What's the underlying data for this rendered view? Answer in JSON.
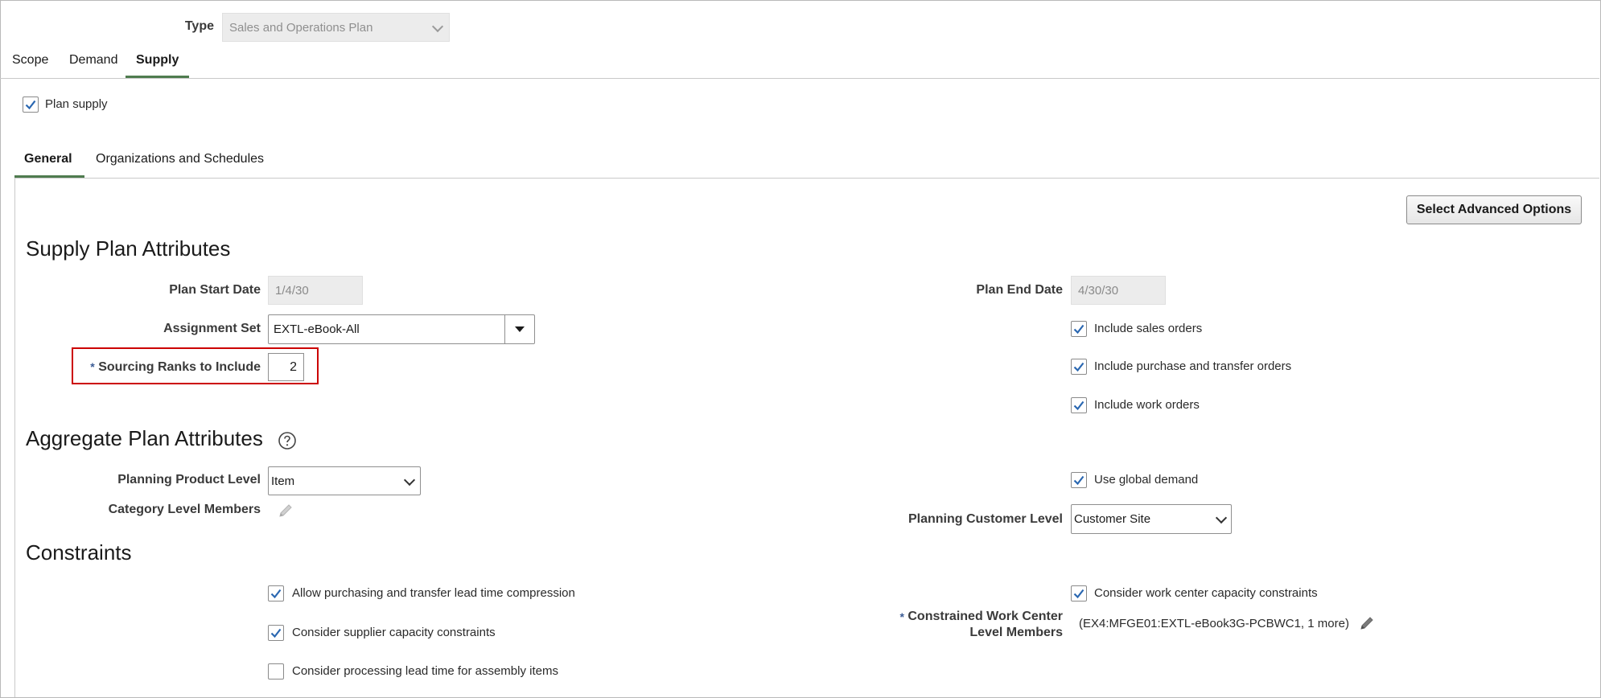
{
  "type_field": {
    "label": "Type",
    "value": "Sales and Operations Plan"
  },
  "main_tabs": [
    {
      "label": "Scope",
      "active": false
    },
    {
      "label": "Demand",
      "active": false
    },
    {
      "label": "Supply",
      "active": true
    }
  ],
  "plan_supply": {
    "label": "Plan supply",
    "checked": true
  },
  "sub_tabs": [
    {
      "label": "General",
      "active": true
    },
    {
      "label": "Organizations and Schedules",
      "active": false
    }
  ],
  "advanced_button": "Select Advanced Options",
  "supply_plan": {
    "title": "Supply Plan Attributes",
    "start_date": {
      "label": "Plan Start Date",
      "value": "1/4/30"
    },
    "end_date": {
      "label": "Plan End Date",
      "value": "4/30/30"
    },
    "assignment_set": {
      "label": "Assignment Set",
      "value": "EXTL-eBook-All"
    },
    "sourcing_ranks": {
      "required_mark": "*",
      "label": "Sourcing Ranks to Include",
      "value": "2"
    },
    "include_sales_orders": {
      "label": "Include sales orders",
      "checked": true
    },
    "include_purchase_orders": {
      "label": "Include purchase and transfer orders",
      "checked": true
    },
    "include_work_orders": {
      "label": "Include work orders",
      "checked": true
    }
  },
  "aggregate_plan": {
    "title": "Aggregate Plan Attributes",
    "help_icon": "question-circle-icon",
    "product_level": {
      "label": "Planning Product Level",
      "value": "Item"
    },
    "category_members": {
      "label": "Category Level Members"
    },
    "use_global_demand": {
      "label": "Use global demand",
      "checked": true
    },
    "customer_level": {
      "label": "Planning Customer Level",
      "value": "Customer Site"
    }
  },
  "constraints": {
    "title": "Constraints",
    "allow_lead_time": {
      "label": "Allow purchasing and transfer lead time compression",
      "checked": true
    },
    "supplier_capacity": {
      "label": "Consider supplier capacity constraints",
      "checked": true
    },
    "processing_lead_time": {
      "label": "Consider processing lead time for assembly items",
      "checked": false
    },
    "work_center_capacity": {
      "label": "Consider work center capacity constraints",
      "checked": true
    },
    "work_center_members": {
      "required_mark": "*",
      "label_line1": "Constrained Work Center",
      "label_line2": "Level Members",
      "value": "(EX4:MFGE01:EXTL-eBook3G-PCBWC1, 1 more)"
    }
  },
  "colors": {
    "active_tab_underline": "#4f7c4f",
    "checkbox_check": "#2a67b1",
    "highlight_box": "#cc0000"
  }
}
